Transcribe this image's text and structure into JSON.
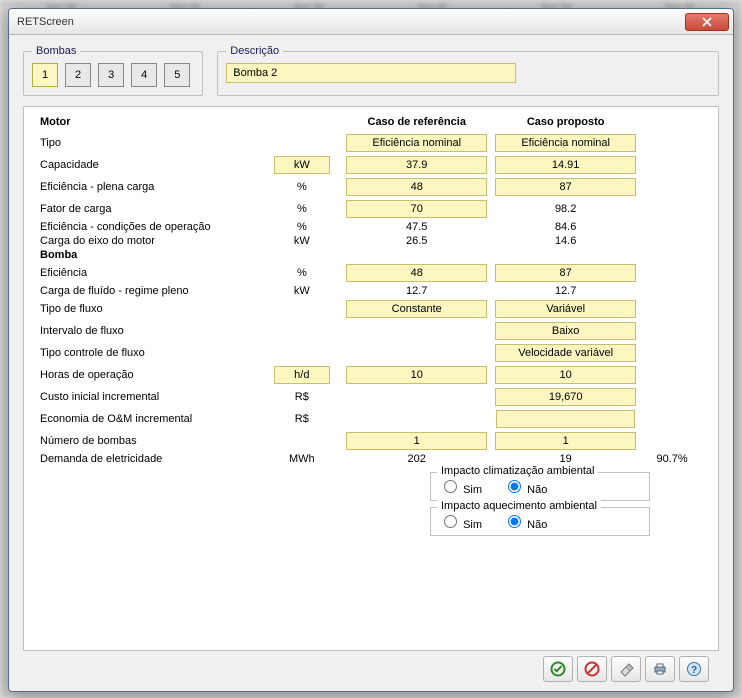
{
  "blurred_header": "tipo de",
  "window": {
    "title": "RETScreen"
  },
  "groups": {
    "bombas": "Bombas",
    "descricao": "Descrição"
  },
  "tabs": [
    "1",
    "2",
    "3",
    "4",
    "5"
  ],
  "active_tab_index": 0,
  "description_value": "Bomba 2",
  "columns": {
    "label": "",
    "unit": "",
    "ref": "Caso de referência",
    "prop": "Caso proposto",
    "extra": ""
  },
  "sections": {
    "motor": "Motor",
    "bomba": "Bomba"
  },
  "rows": {
    "tipo": {
      "label": "Tipo",
      "unit": "",
      "unit_box": false,
      "ref": "Eficiência nominal",
      "ref_box": true,
      "prop": "Eficiência nominal",
      "prop_box": true
    },
    "capacidade": {
      "label": "Capacidade",
      "unit": "kW",
      "unit_box": true,
      "ref": "37.9",
      "ref_box": true,
      "prop": "14.91",
      "prop_box": true
    },
    "ef_plena": {
      "label": "Eficiência - plena carga",
      "unit": "%",
      "unit_box": false,
      "ref": "48",
      "ref_box": true,
      "prop": "87",
      "prop_box": true
    },
    "fator_carga": {
      "label": "Fator de carga",
      "unit": "%",
      "unit_box": false,
      "ref": "70",
      "ref_box": true,
      "prop": "98.2",
      "prop_box": false
    },
    "ef_cond": {
      "label": "Eficiência - condições de operação",
      "unit": "%",
      "unit_box": false,
      "ref": "47.5",
      "ref_box": false,
      "prop": "84.6",
      "prop_box": false
    },
    "carga_eixo": {
      "label": "Carga do eixo do motor",
      "unit": "kW",
      "unit_box": false,
      "ref": "26.5",
      "ref_box": false,
      "prop": "14.6",
      "prop_box": false
    },
    "b_ef": {
      "label": "Eficiência",
      "unit": "%",
      "unit_box": false,
      "ref": "48",
      "ref_box": true,
      "prop": "87",
      "prop_box": true
    },
    "b_carga": {
      "label": "Carga de fluído - regime pleno",
      "unit": "kW",
      "unit_box": false,
      "ref": "12.7",
      "ref_box": false,
      "prop": "12.7",
      "prop_box": false
    },
    "b_tipo": {
      "label": "Tipo de fluxo",
      "unit": "",
      "unit_box": false,
      "ref": "Constante",
      "ref_box": true,
      "prop": "Variável",
      "prop_box": true
    },
    "b_int": {
      "label": "Intervalo de fluxo",
      "unit": "",
      "unit_box": false,
      "ref": "",
      "ref_box": false,
      "prop": "Baixo",
      "prop_box": true
    },
    "b_ctrl": {
      "label": "Tipo controle de fluxo",
      "unit": "",
      "unit_box": false,
      "ref": "",
      "ref_box": false,
      "prop": "Velocidade variável",
      "prop_box": true
    },
    "b_horas": {
      "label": "Horas de operação",
      "unit": "h/d",
      "unit_box": true,
      "ref": "10",
      "ref_box": true,
      "prop": "10",
      "prop_box": true
    },
    "b_custo": {
      "label": "Custo inicial incremental",
      "unit": "R$",
      "unit_box": false,
      "ref": "",
      "ref_box": false,
      "prop": "19,670",
      "prop_box": true
    },
    "b_econ": {
      "label": "Economia de O&M incremental",
      "unit": "R$",
      "unit_box": false,
      "ref": "",
      "ref_box": false,
      "prop": "",
      "prop_box": true,
      "prop_is_input": true
    },
    "b_num": {
      "label": "Número de bombas",
      "unit": "",
      "unit_box": false,
      "ref": "1",
      "ref_box": true,
      "prop": "1",
      "prop_box": true
    },
    "b_dem": {
      "label": "Demanda de eletricidade",
      "unit": "MWh",
      "unit_box": false,
      "ref": "202",
      "ref_box": false,
      "prop": "19",
      "prop_box": false,
      "extra": "90.7%"
    }
  },
  "impact": {
    "clima": {
      "legend": "Impacto climatização ambiental",
      "sim": "Sim",
      "nao": "Não",
      "value": "nao"
    },
    "aquec": {
      "legend": "Impacto aquecimento ambiental",
      "sim": "Sim",
      "nao": "Não",
      "value": "nao"
    }
  },
  "footer_icons": {
    "ok": "ok-icon",
    "cancel": "cancel-icon",
    "clear": "clear-icon",
    "print": "print-icon",
    "help": "help-icon"
  }
}
